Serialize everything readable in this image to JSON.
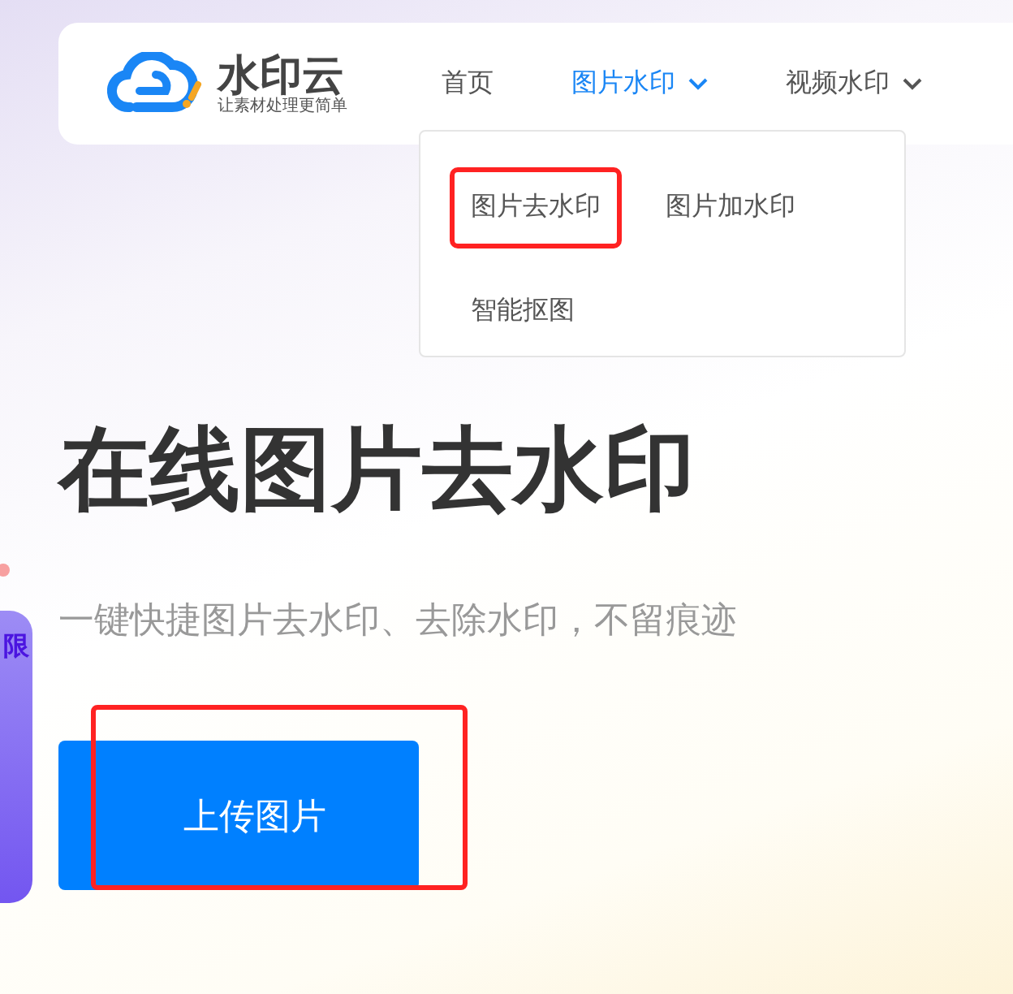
{
  "logo": {
    "name": "水印云",
    "tagline": "让素材处理更简单"
  },
  "nav": [
    {
      "label": "首页",
      "selected": false,
      "has_dropdown": false
    },
    {
      "label": "图片水印",
      "selected": true,
      "has_dropdown": true
    },
    {
      "label": "视频水印",
      "selected": false,
      "has_dropdown": true
    }
  ],
  "dropdown": [
    {
      "label": "图片去水印",
      "highlighted": true
    },
    {
      "label": "图片加水印",
      "highlighted": false
    },
    {
      "label": "智能抠图",
      "highlighted": false
    }
  ],
  "side_tab": {
    "label": "限"
  },
  "hero": {
    "title": "在线图片去水印",
    "subtitle": "一键快捷图片去水印、去除水印，不留痕迹"
  },
  "upload_button": {
    "label": "上传图片",
    "highlighted": true
  }
}
